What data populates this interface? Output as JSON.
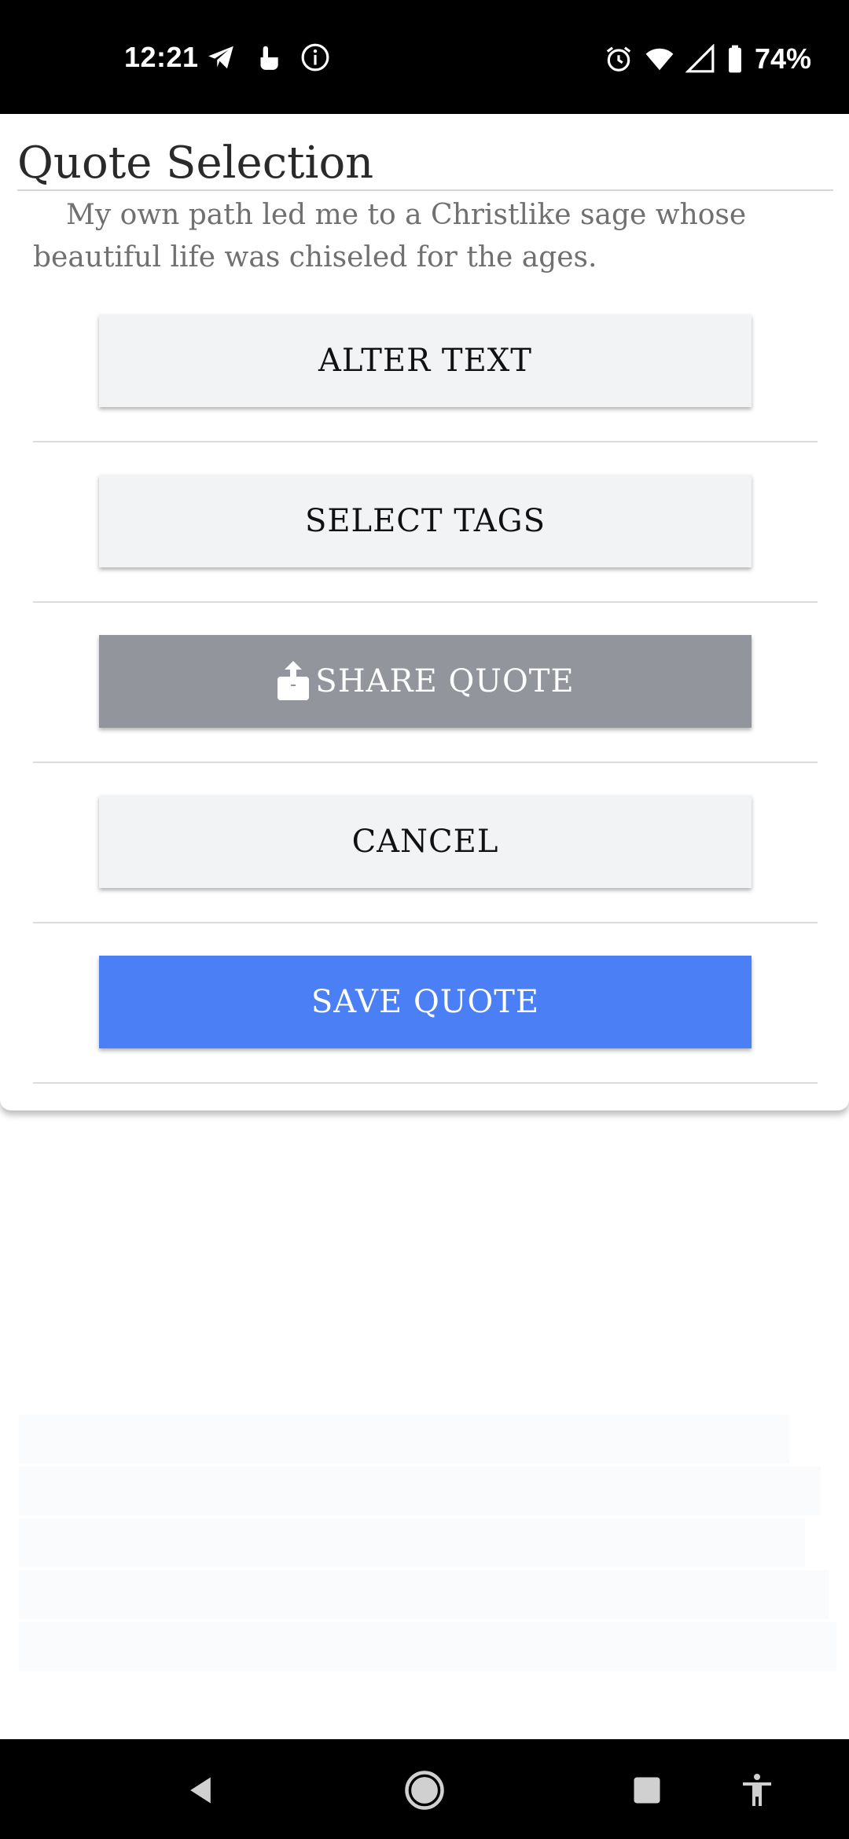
{
  "status_bar": {
    "time": "12:21",
    "battery": "74%",
    "icons_left": [
      "telegram-icon",
      "touch-icon",
      "info-icon"
    ],
    "icons_right": [
      "alarm-icon",
      "wifi-icon",
      "signal-icon",
      "battery-icon"
    ]
  },
  "dialog": {
    "title": "Quote Selection",
    "quote": "My own path led me to a Christlike sage whose beautiful life was chiseled for the ages.",
    "buttons": {
      "alter_text": "ALTER TEXT",
      "select_tags": "SELECT TAGS",
      "share_quote": "SHARE QUOTE",
      "cancel": "CANCEL",
      "save_quote": "SAVE QUOTE"
    }
  },
  "colors": {
    "share_button": "#93959c",
    "save_button": "#4a7ff5",
    "light_button": "#f2f3f5"
  },
  "nav_bar": {
    "icons": [
      "back-icon",
      "home-icon",
      "recents-icon",
      "accessibility-icon"
    ]
  }
}
